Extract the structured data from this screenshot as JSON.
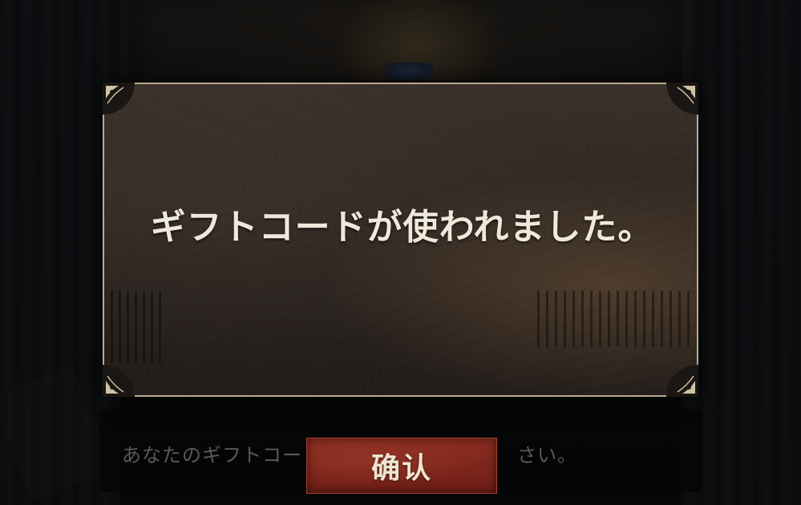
{
  "dialog": {
    "message": "ギフトコードが使われました。"
  },
  "code_input": {
    "placeholder": "あなたのギフトコードを入力してください。",
    "visible_left": "あなたのギフトコー",
    "visible_right": "さい。"
  },
  "confirm_button": {
    "label": "确认"
  },
  "colors": {
    "dialog_border": "#b9ab91",
    "button_red": "#8e2e22",
    "message_text": "#efe9dc"
  }
}
